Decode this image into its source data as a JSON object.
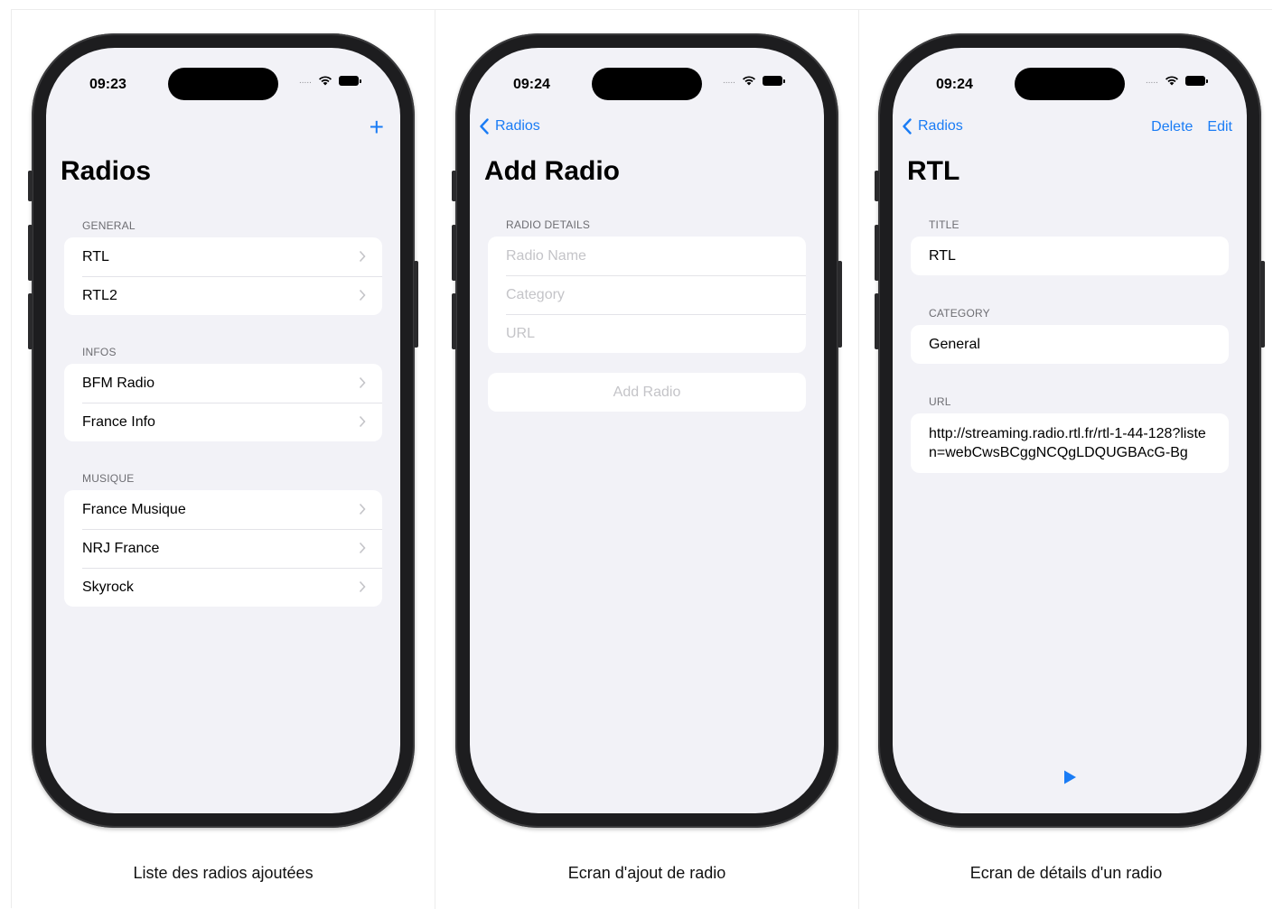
{
  "screens": [
    {
      "time": "09:23",
      "status_dots": ".....",
      "title": "Radios",
      "add_icon": "+",
      "sections": [
        {
          "header": "GENERAL",
          "items": [
            {
              "label": "RTL"
            },
            {
              "label": "RTL2"
            }
          ]
        },
        {
          "header": "INFOS",
          "items": [
            {
              "label": "BFM Radio"
            },
            {
              "label": "France Info"
            }
          ]
        },
        {
          "header": "MUSIQUE",
          "items": [
            {
              "label": "France Musique"
            },
            {
              "label": "NRJ France"
            },
            {
              "label": "Skyrock"
            }
          ]
        }
      ],
      "caption": "Liste des radios ajoutées"
    },
    {
      "time": "09:24",
      "status_dots": ".....",
      "back_label": "Radios",
      "title": "Add Radio",
      "section_header": "RADIO DETAILS",
      "fields": [
        {
          "placeholder": "Radio Name"
        },
        {
          "placeholder": "Category"
        },
        {
          "placeholder": "URL"
        }
      ],
      "add_button_label": "Add Radio",
      "caption": "Ecran d'ajout de radio"
    },
    {
      "time": "09:24",
      "status_dots": ".....",
      "back_label": "Radios",
      "delete_label": "Delete",
      "edit_label": "Edit",
      "title": "RTL",
      "title_header": "TITLE",
      "title_value": "RTL",
      "category_header": "CATEGORY",
      "category_value": "General",
      "url_header": "URL",
      "url_value": "http://streaming.radio.rtl.fr/rtl-1-44-128?listen=webCwsBCggNCQgLDQUGBAcG-Bg",
      "play_icon": "play-icon",
      "caption": "Ecran de détails d'un radio"
    }
  ],
  "colors": {
    "accent": "#1a7cf5",
    "background": "#f2f2f7",
    "placeholder": "#c4c4c8"
  }
}
